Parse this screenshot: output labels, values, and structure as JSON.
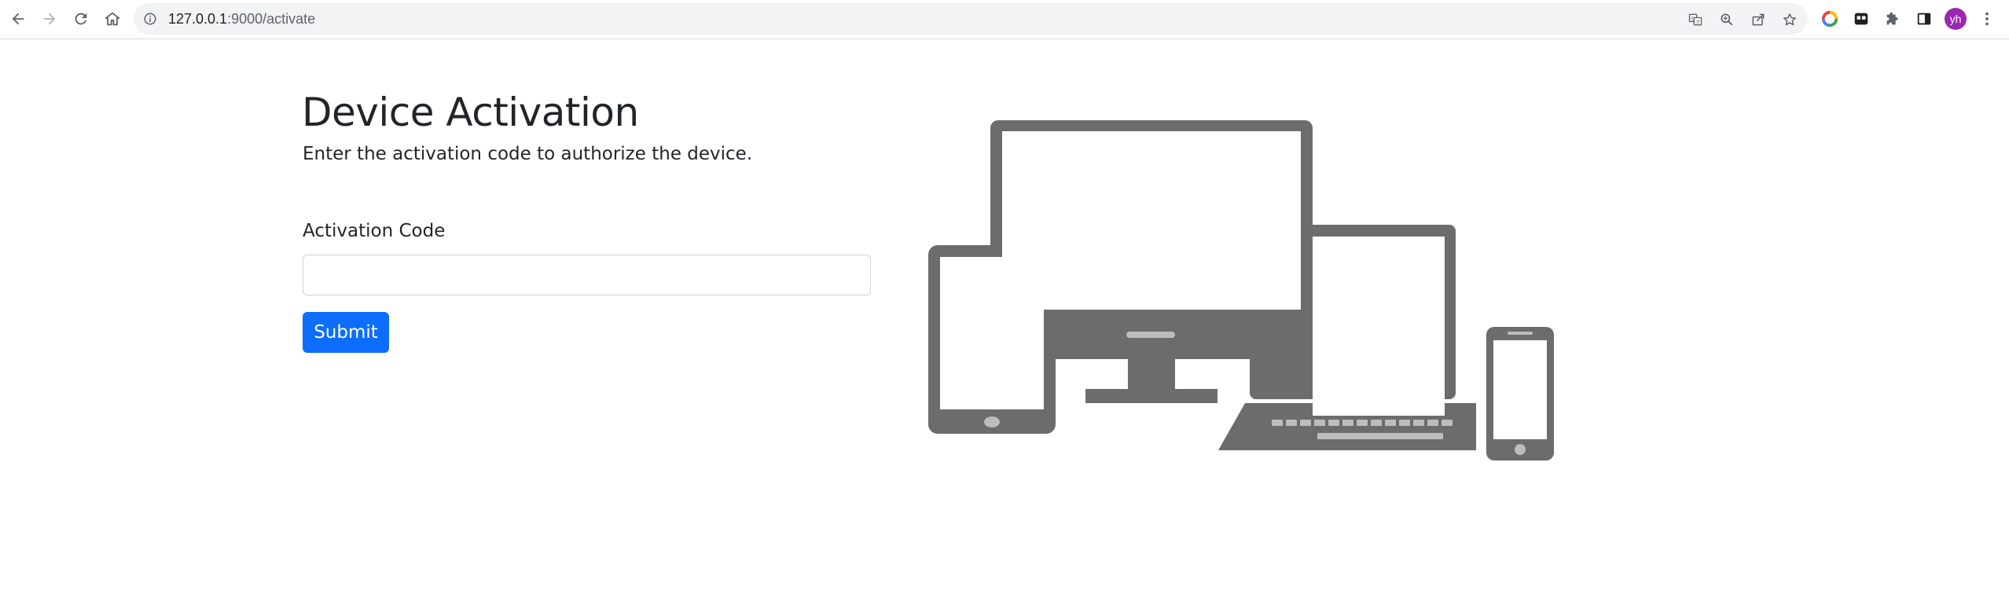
{
  "browser": {
    "url_host": "127.0.0.1",
    "url_path": ":9000/activate",
    "profile_initials": "yh",
    "icons": {
      "back": "back-arrow-icon",
      "forward": "forward-arrow-icon",
      "reload": "reload-icon",
      "home": "home-icon",
      "site_info": "info-icon",
      "translate": "translate-icon",
      "zoom": "zoom-icon",
      "share": "share-icon",
      "bookmark": "star-icon",
      "extension_1": "color-wheel-icon",
      "extension_2": "extension-app-icon",
      "extensions": "puzzle-icon",
      "side_panel": "side-panel-icon",
      "menu": "kebab-menu-icon"
    },
    "colors": {
      "avatar": "#9c27b0",
      "omnibox": "#f1f3f4"
    }
  },
  "page": {
    "title": "Device Activation",
    "subtitle": "Enter the activation code to authorize the device.",
    "form": {
      "code_label": "Activation Code",
      "code_value": "",
      "submit_label": "Submit"
    },
    "illustration": "devices-illustration",
    "colors": {
      "primary_button": "#0d6efd",
      "illustration": "#6c6c6c"
    }
  }
}
